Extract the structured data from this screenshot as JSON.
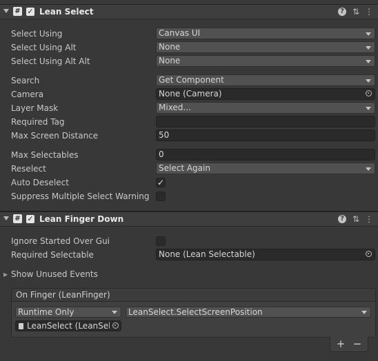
{
  "components": [
    {
      "title": "Lean Select",
      "enabled": true
    },
    {
      "title": "Lean Finger Down",
      "enabled": true
    }
  ],
  "icons": {
    "script": "#",
    "help": "?",
    "presets": "⇅",
    "menu": "⋮",
    "check": "✓",
    "foldout_collapsed": "▶",
    "plus": "+",
    "minus": "−"
  },
  "lean_select": {
    "select_using": {
      "label": "Select Using",
      "value": "Canvas UI"
    },
    "select_using_alt": {
      "label": "Select Using Alt",
      "value": "None"
    },
    "select_using_alt_alt": {
      "label": "Select Using Alt Alt",
      "value": "None"
    },
    "search": {
      "label": "Search",
      "value": "Get Component"
    },
    "camera": {
      "label": "Camera",
      "value": "None (Camera)"
    },
    "layer_mask": {
      "label": "Layer Mask",
      "value": "Mixed..."
    },
    "required_tag": {
      "label": "Required Tag",
      "value": ""
    },
    "max_screen_distance": {
      "label": "Max Screen Distance",
      "value": "50"
    },
    "max_selectables": {
      "label": "Max Selectables",
      "value": "0"
    },
    "reselect": {
      "label": "Reselect",
      "value": "Select Again"
    },
    "auto_deselect": {
      "label": "Auto Deselect",
      "checked": true
    },
    "suppress_warning": {
      "label": "Suppress Multiple Select Warning",
      "checked": false
    }
  },
  "lean_finger_down": {
    "ignore_started_over_gui": {
      "label": "Ignore Started Over Gui",
      "checked": false
    },
    "required_selectable": {
      "label": "Required Selectable",
      "value": "None (Lean Selectable)"
    },
    "show_unused_events": "Show Unused Events",
    "event": {
      "header": "On Finger (LeanFinger)",
      "runtime": "Runtime Only",
      "function": "LeanSelect.SelectScreenPosition",
      "object": "LeanSelect (LeanSele"
    }
  }
}
